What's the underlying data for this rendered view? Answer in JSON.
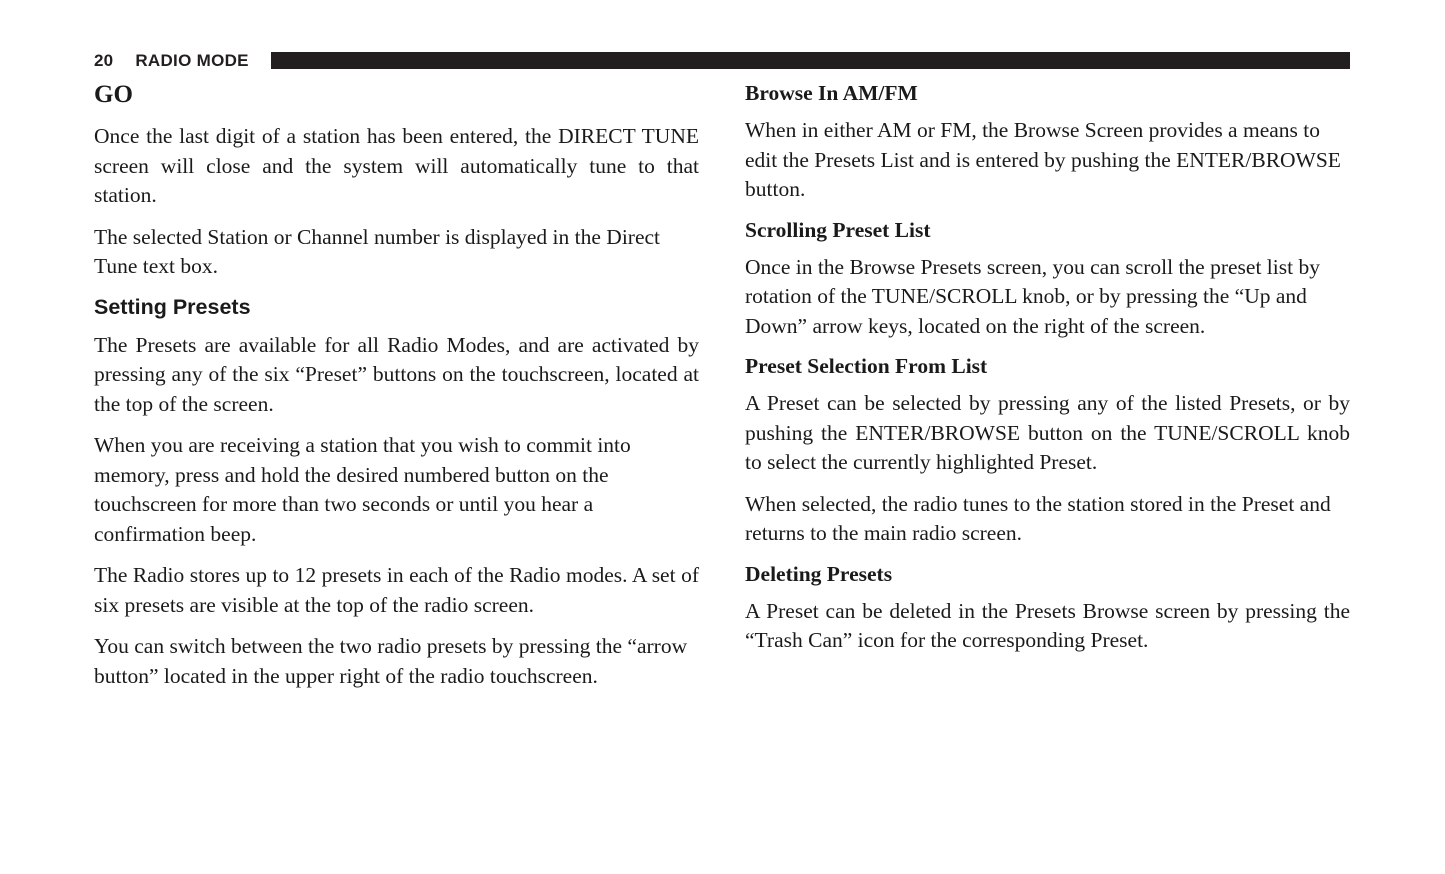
{
  "header": {
    "page_number": "20",
    "title": "RADIO MODE",
    "rule_color": "#231f20"
  },
  "left_column": {
    "heading_go": "GO",
    "p1": "Once the last digit of a station has been entered, the DIRECT TUNE screen will close and the system will automatically tune to that station.",
    "p2": "The selected Station or Channel number is displayed in the Direct Tune text box.",
    "heading_setting_presets": "Setting Presets",
    "p3": "The Presets are available for all Radio Modes, and are activated by pressing any of the six “Preset” buttons on the touchscreen, located at the top of the screen.",
    "p4": "When you are receiving a station that you wish to commit into memory, press and hold the desired numbered button on the touchscreen for more than two seconds or until you hear a confirmation beep.",
    "p5": "The Radio stores up to 12 presets in each of the Radio modes. A set of six presets are visible at the top of the radio screen.",
    "p6": "You can switch between the two radio presets by pressing the “arrow button” located in the upper right of the radio touchscreen."
  },
  "right_column": {
    "heading_browse": "Browse In AM/FM",
    "p1": "When in either AM or FM, the Browse Screen provides a means to edit the Presets List and is entered by pushing the ENTER/BROWSE button.",
    "heading_scrolling": "Scrolling Preset List",
    "p2": "Once in the Browse Presets screen, you can scroll the preset list by rotation of the TUNE/SCROLL knob, or by pressing the “Up and Down” arrow keys, located on the right of the screen.",
    "heading_preset_selection": "Preset Selection From List",
    "p3": "A Preset can be selected by pressing any of the listed Presets, or by pushing the ENTER/BROWSE button on the TUNE/SCROLL knob to select the currently highlighted Preset.",
    "p4": "When selected, the radio tunes to the station stored in the Preset and returns to the main radio screen.",
    "heading_deleting": "Deleting Presets",
    "p5": "A Preset can be deleted in the Presets Browse screen by pressing the “Trash Can” icon for the corresponding Preset."
  }
}
